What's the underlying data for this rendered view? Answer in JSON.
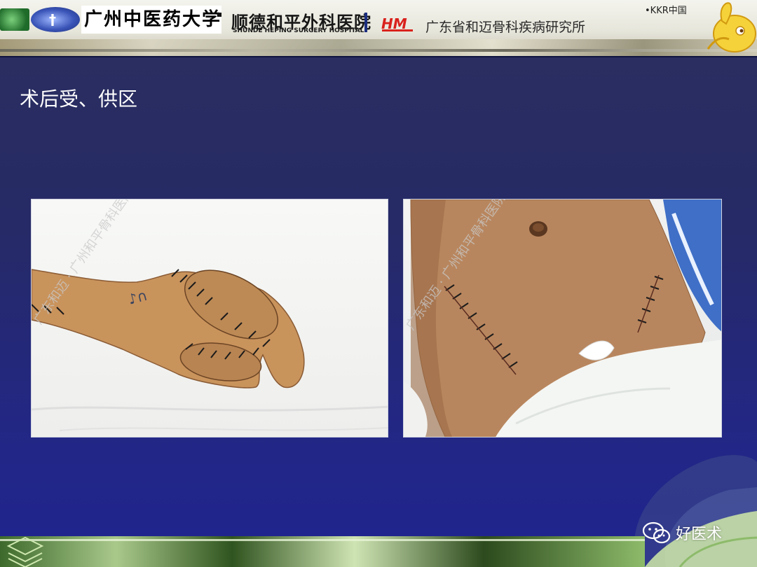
{
  "header": {
    "university_name": "广州中医药大学",
    "hospital_name": "顺德和平外科医院",
    "hospital_name_en": "SHUNDE HEPING SURGERY HOSPITAL",
    "hm_logo_text": "HM",
    "institute_name": "广东省和迈骨科疾病研究所",
    "kkr_label": "•KKR中国"
  },
  "slide": {
    "title": "术后受、供区"
  },
  "photos": {
    "left_watermark": "广东和迈 · 广州和平骨科医院",
    "right_watermark": "广东和迈 · 广州和平骨科医院"
  },
  "footer": {
    "wechat_label": "好医术"
  },
  "colors": {
    "background_top": "#2b2f5e",
    "background_bottom": "#1f2490",
    "title_text": "#ffffff",
    "hm_red": "#d9211c",
    "separator_blue": "#1c2f80"
  }
}
